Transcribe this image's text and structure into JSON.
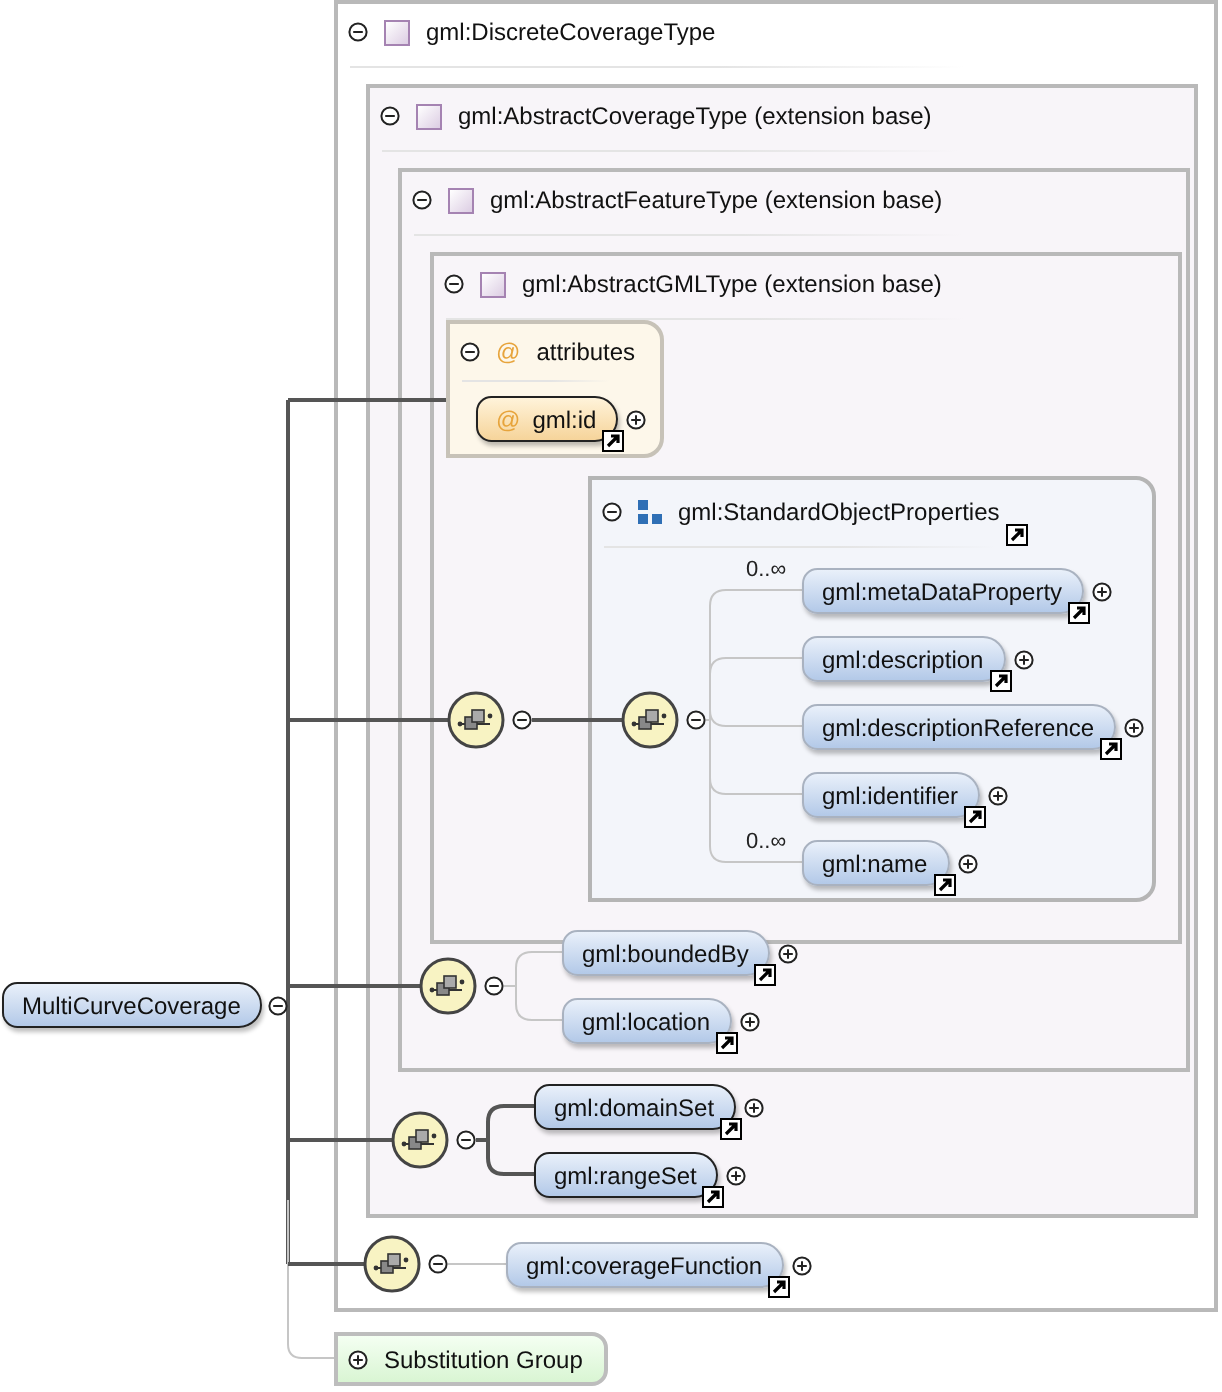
{
  "root": {
    "name": "MultiCurveCoverage",
    "expanded": true,
    "optional": false
  },
  "complex_type": {
    "title": "gml:DiscreteCoverageType",
    "expanded": true,
    "base": {
      "title": "gml:AbstractCoverageType (extension base)",
      "expanded": true,
      "base": {
        "title": "gml:AbstractFeatureType (extension base)",
        "expanded": true,
        "base": {
          "title": "gml:AbstractGMLType (extension base)",
          "expanded": true
        }
      }
    }
  },
  "attributes": {
    "marker": "@",
    "title": "attributes",
    "expanded": true,
    "items": [
      {
        "marker": "@",
        "name": "gml:id",
        "expanded": false
      }
    ]
  },
  "sequences": [
    {
      "kind": "group",
      "expanded": true,
      "inner": {
        "expanded": true
      },
      "group": {
        "title": "gml:StandardObjectProperties",
        "expanded": true,
        "elements": [
          {
            "name": "gml:metaDataProperty",
            "occurs": "0..∞",
            "optional": true,
            "expanded": false
          },
          {
            "name": "gml:description",
            "optional": true,
            "expanded": false
          },
          {
            "name": "gml:descriptionReference",
            "optional": true,
            "expanded": false
          },
          {
            "name": "gml:identifier",
            "optional": true,
            "expanded": false
          },
          {
            "name": "gml:name",
            "occurs": "0..∞",
            "optional": true,
            "expanded": false
          }
        ]
      }
    },
    {
      "kind": "elements",
      "expanded": true,
      "elements": [
        {
          "name": "gml:boundedBy",
          "optional": true,
          "expanded": false
        },
        {
          "name": "gml:location",
          "optional": true,
          "expanded": false
        }
      ]
    },
    {
      "kind": "elements",
      "expanded": true,
      "elements": [
        {
          "name": "gml:domainSet",
          "optional": false,
          "expanded": false
        },
        {
          "name": "gml:rangeSet",
          "optional": false,
          "expanded": false
        }
      ]
    },
    {
      "kind": "elements",
      "expanded": true,
      "elements": [
        {
          "name": "gml:coverageFunction",
          "optional": true,
          "expanded": false
        }
      ]
    }
  ],
  "substitution_group": {
    "label": "Substitution Group",
    "expanded": false
  }
}
